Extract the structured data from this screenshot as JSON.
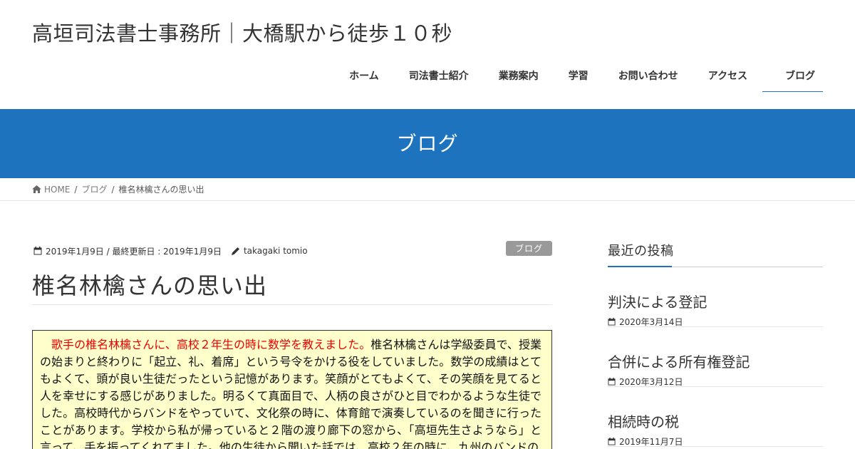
{
  "site": {
    "title": "高垣司法書士事務所｜大橋駅から徒歩１０秒"
  },
  "nav": {
    "items": [
      {
        "label": "ホーム"
      },
      {
        "label": "司法書士紹介"
      },
      {
        "label": "業務案内"
      },
      {
        "label": "学習"
      },
      {
        "label": "お問い合わせ"
      },
      {
        "label": "アクセス"
      },
      {
        "label": "ブログ",
        "current": true
      }
    ]
  },
  "page_header": {
    "title": "ブログ"
  },
  "breadcrumb": {
    "home": "HOME",
    "category": "ブログ",
    "current": "椎名林檎さんの思い出",
    "separator": "/"
  },
  "entry": {
    "date_text": "2019年1月9日 / 最終更新日 : 2019年1月9日",
    "author": "takagaki tomio",
    "category": "ブログ",
    "title": "椎名林檎さんの思い出",
    "lead": "　歌手の椎名林檎さんに、高校２年生の時に数学を教えました。",
    "body": "椎名林檎さんは学級委員で、授業の始まりと終わりに「起立、礼、着席」という号令をかける役をしていました。数学の成績はとてもよくて、頭が良い生徒だったという記憶があります。笑顔がとてもよくて、その笑顔を見てると人を幸せにする感じがありました。明るくて真面目で、人柄の良さがひと目でわかるような生徒でした。高校時代からバンドをやっていて、文化祭の時に、体育館で演奏しているのを聞きに行ったことがあります。学校から私が帰っていると２階の渡り廊下の窓から、「高垣先生さようなら」と言って、手を振ってくれてました。他の生徒から聞いた話では、高校２年の時に、九州のバンドの"
  },
  "sidebar": {
    "recent_title": "最近の投稿",
    "posts": [
      {
        "title": "判決による登記",
        "date": "2020年3月14日"
      },
      {
        "title": "合併による所有権登記",
        "date": "2020年3月12日"
      },
      {
        "title": "相続時の税",
        "date": "2019年11月7日"
      }
    ]
  },
  "colors": {
    "accent": "#1e73be",
    "lead_text": "#ee0000",
    "box_bg": "#ffffcc",
    "badge": "#999999"
  }
}
